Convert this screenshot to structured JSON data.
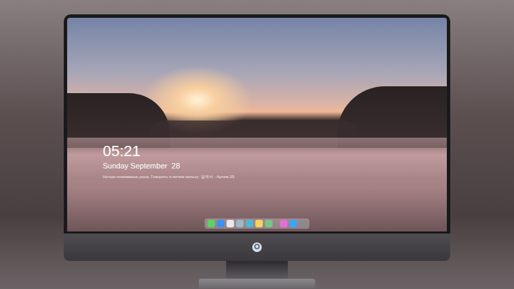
{
  "lock_screen": {
    "time": "05:21",
    "date": "Sunday September  28",
    "quote": "Ночью понимаешь роса, Говорить я ничем нельзу: 앞에서 - Артем 25"
  },
  "dock": {
    "items": [
      {
        "color": "#5fd068"
      },
      {
        "color": "#3d8ff0"
      },
      {
        "color": "#e8e8e8"
      },
      {
        "color": "#9fb8c9"
      },
      {
        "color": "#4fb6d8"
      },
      {
        "color": "#f4d35e"
      },
      {
        "color": "#7cc48a"
      },
      {
        "color": "#e36fd6"
      },
      {
        "color": "#3aa5f5"
      },
      {
        "color": "#8a8a90"
      }
    ]
  }
}
